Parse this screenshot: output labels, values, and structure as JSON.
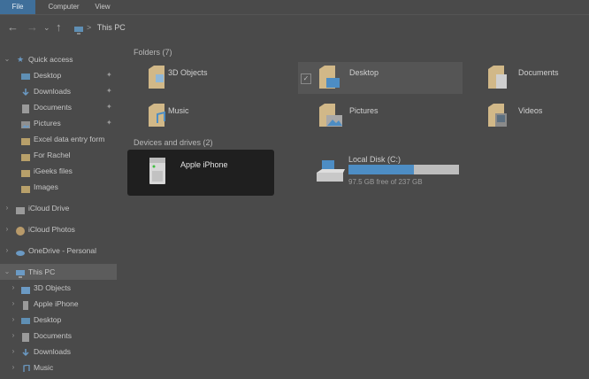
{
  "ribbon": {
    "tabs": [
      {
        "label": "File",
        "active": true
      },
      {
        "label": "Computer",
        "active": false
      },
      {
        "label": "View",
        "active": false
      }
    ]
  },
  "address": {
    "location": "This PC",
    "separator": ">"
  },
  "sidebar": {
    "quick_access": {
      "label": "Quick access"
    },
    "quick_items": [
      {
        "label": "Desktop",
        "pinned": true,
        "icon": "desktop-icon"
      },
      {
        "label": "Downloads",
        "pinned": true,
        "icon": "download-icon"
      },
      {
        "label": "Documents",
        "pinned": true,
        "icon": "documents-icon"
      },
      {
        "label": "Pictures",
        "pinned": true,
        "icon": "pictures-icon"
      },
      {
        "label": "Excel data entry form",
        "pinned": false,
        "icon": "folder-icon"
      },
      {
        "label": "For Rachel",
        "pinned": false,
        "icon": "folder-icon"
      },
      {
        "label": "iGeeks files",
        "pinned": false,
        "icon": "folder-icon"
      },
      {
        "label": "Images",
        "pinned": false,
        "icon": "folder-icon"
      }
    ],
    "icloud_drive": {
      "label": "iCloud Drive"
    },
    "icloud_photos": {
      "label": "iCloud Photos"
    },
    "onedrive": {
      "label": "OneDrive - Personal"
    },
    "this_pc": {
      "label": "This PC"
    },
    "this_pc_items": [
      {
        "label": "3D Objects",
        "icon": "3d-objects-icon"
      },
      {
        "label": "Apple iPhone",
        "icon": "iphone-icon"
      },
      {
        "label": "Desktop",
        "icon": "desktop-icon"
      },
      {
        "label": "Documents",
        "icon": "documents-icon"
      },
      {
        "label": "Downloads",
        "icon": "download-icon"
      },
      {
        "label": "Music",
        "icon": "music-icon"
      }
    ]
  },
  "content": {
    "folders_header": "Folders (7)",
    "folders": [
      {
        "label": "3D Objects",
        "icon": "3d-objects-folder-icon"
      },
      {
        "label": "Desktop",
        "icon": "desktop-folder-icon",
        "hovered": true,
        "checked": true
      },
      {
        "label": "Documents",
        "icon": "documents-folder-icon"
      },
      {
        "label": "Music",
        "icon": "music-folder-icon"
      },
      {
        "label": "Pictures",
        "icon": "pictures-folder-icon"
      },
      {
        "label": "Videos",
        "icon": "videos-folder-icon"
      }
    ],
    "devices_header": "Devices and drives (2)",
    "devices": [
      {
        "label": "Apple iPhone",
        "icon": "portable-device-icon",
        "selected": true
      },
      {
        "label": "Local Disk (C:)",
        "icon": "hard-drive-icon",
        "free_text": "97.5 GB free of 237 GB",
        "used_fraction": 0.59
      }
    ]
  },
  "colors": {
    "accent": "#3f6f9a",
    "bar_fill": "#4d8dc4",
    "selection": "#1f1f1f",
    "background": "#4a4a4a"
  }
}
